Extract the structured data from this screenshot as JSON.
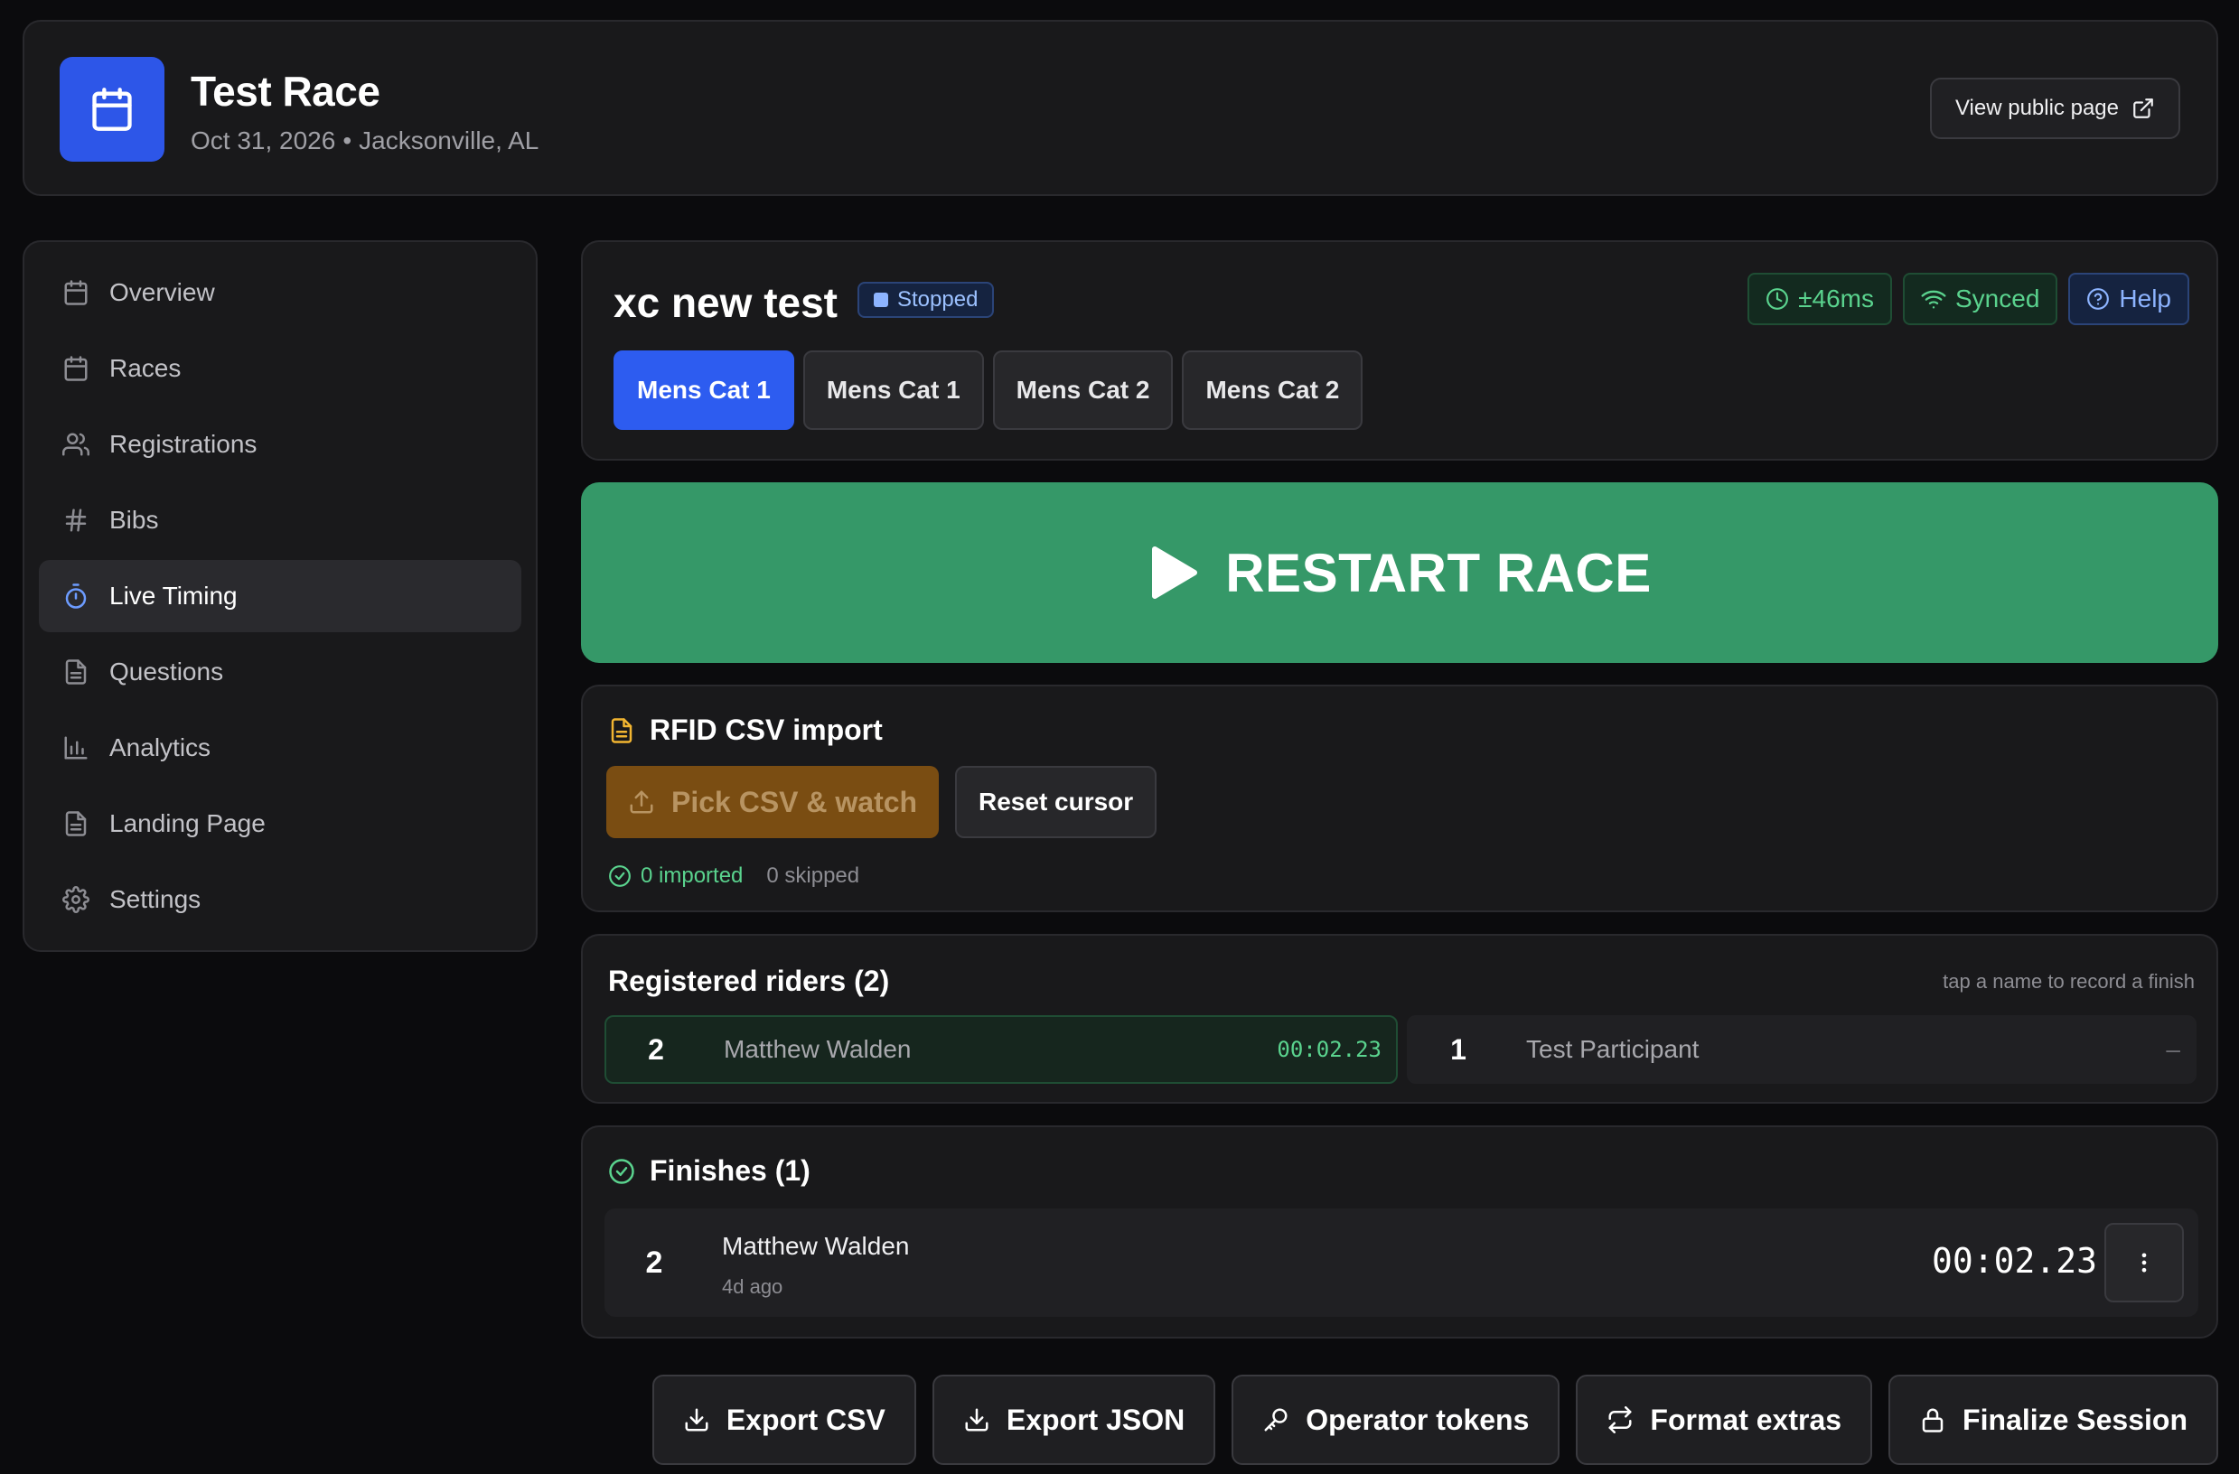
{
  "event": {
    "title": "Test Race",
    "date": "Oct 31, 2026",
    "separator": "•",
    "location": "Jacksonville, AL",
    "public_page_label": "View public page"
  },
  "sidebar": {
    "items": [
      {
        "label": "Overview",
        "icon": "calendar-icon",
        "active": false
      },
      {
        "label": "Races",
        "icon": "calendar-icon",
        "active": false
      },
      {
        "label": "Registrations",
        "icon": "users-icon",
        "active": false
      },
      {
        "label": "Bibs",
        "icon": "hash-icon",
        "active": false
      },
      {
        "label": "Live Timing",
        "icon": "stopwatch-icon",
        "active": true
      },
      {
        "label": "Questions",
        "icon": "document-icon",
        "active": false
      },
      {
        "label": "Analytics",
        "icon": "bar-chart-icon",
        "active": false
      },
      {
        "label": "Landing Page",
        "icon": "document-icon",
        "active": false
      },
      {
        "label": "Settings",
        "icon": "gear-icon",
        "active": false
      }
    ]
  },
  "session": {
    "title": "xc new test",
    "status": "Stopped",
    "clock_offset": "±46ms",
    "sync_status": "Synced",
    "help_label": "Help",
    "categories": [
      "Mens Cat 1",
      "Mens Cat 1",
      "Mens Cat 2",
      "Mens Cat 2"
    ],
    "active_category_index": 0
  },
  "restart": {
    "label": "RESTART RACE"
  },
  "rfid": {
    "title": "RFID CSV import",
    "pick_label": "Pick CSV & watch",
    "reset_label": "Reset cursor",
    "imported_text": "0 imported",
    "skipped_text": "0 skipped"
  },
  "riders": {
    "title": "Registered riders (2)",
    "hint": "tap a name to record a finish",
    "list": [
      {
        "bib": "2",
        "name": "Matthew Walden",
        "time": "00:02.23"
      },
      {
        "bib": "1",
        "name": "Test Participant",
        "time": "–"
      }
    ]
  },
  "finishes": {
    "title": "Finishes (1)",
    "list": [
      {
        "bib": "2",
        "name": "Matthew Walden",
        "ago": "4d ago",
        "time": "00:02.23"
      }
    ]
  },
  "actions": {
    "export_csv": "Export CSV",
    "export_json": "Export JSON",
    "operator_tokens": "Operator tokens",
    "format_extras": "Format extras",
    "finalize": "Finalize Session"
  },
  "colors": {
    "accent_blue": "#2d5cf0",
    "restart_green": "#359868",
    "success_green": "#5ad38e",
    "warning_amber": "#7a4d12"
  }
}
